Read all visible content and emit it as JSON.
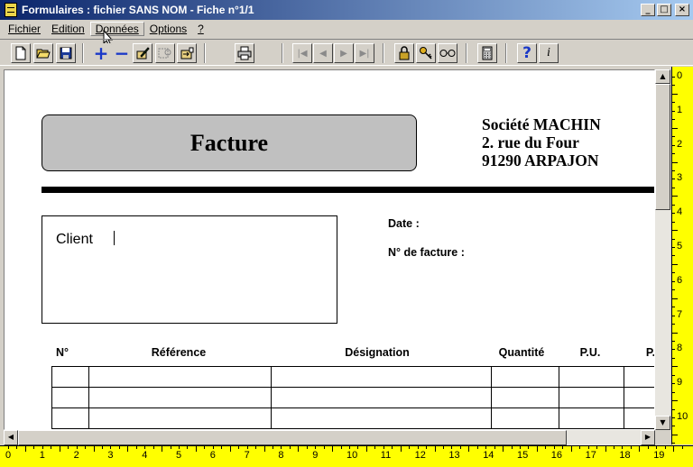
{
  "window": {
    "title": "Formulaires : fichier SANS NOM - Fiche n°1/1",
    "buttons": {
      "minimize": "_",
      "maximize": "□",
      "close": "×"
    }
  },
  "menu": [
    {
      "label": "Fichier",
      "hotkey_index": 0
    },
    {
      "label": "Edition",
      "hotkey_index": 0
    },
    {
      "label": "Données",
      "hotkey_index": 0
    },
    {
      "label": "Options",
      "hotkey_index": 0
    },
    {
      "label": "?",
      "hotkey_index": 0
    }
  ],
  "toolbar": {
    "icons": [
      "new-doc-icon",
      "open-folder-icon",
      "save-disk-icon",
      "add-icon",
      "remove-icon",
      "edit-pencil-icon",
      "search-grid-icon",
      "export-icon",
      "print-icon",
      "first-record-icon",
      "prev-record-icon",
      "next-record-icon",
      "last-record-icon",
      "lock-icon",
      "key-icon",
      "glasses-icon",
      "calculator-icon",
      "help-icon",
      "info-icon"
    ],
    "glyphs": {
      "add": "+",
      "remove": "−",
      "help": "?",
      "info": "i",
      "first": "|◀",
      "prev": "◀",
      "next": "▶",
      "last": "▶|"
    }
  },
  "document": {
    "title": "Facture",
    "company": {
      "name": "Société MACHIN",
      "street": "2. rue du Four",
      "city": "91290 ARPAJON"
    },
    "client_label": "Client",
    "date_label": "Date :",
    "invoice_no_label": "N° de facture :",
    "table_headers": [
      "N°",
      "Référence",
      "Désignation",
      "Quantité",
      "P.U.",
      "P."
    ]
  },
  "rulers": {
    "vertical": [
      "0",
      "1",
      "2",
      "3",
      "4",
      "5",
      "6",
      "7",
      "8",
      "9",
      "10"
    ],
    "horizontal": [
      "0",
      "1",
      "2",
      "3",
      "4",
      "5",
      "6",
      "7",
      "8",
      "9",
      "10",
      "11",
      "12",
      "13",
      "14",
      "15",
      "16",
      "17",
      "18",
      "19"
    ]
  },
  "colors": {
    "titlebar": "#0a246a",
    "ruler": "#ffff00",
    "header_box": "#c0c0c0",
    "face": "#d4d0c8"
  }
}
